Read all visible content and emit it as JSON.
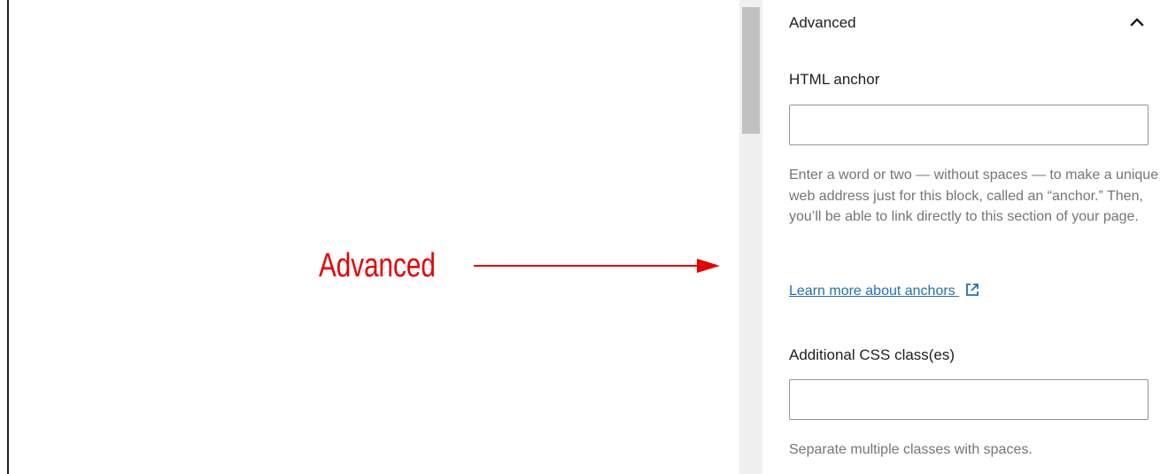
{
  "annotation": {
    "label": "Advanced",
    "color": "#e60000"
  },
  "panel": {
    "title": "Advanced",
    "toggle_icon": "chevron-up-icon",
    "html_anchor": {
      "label": "HTML anchor",
      "value": "",
      "placeholder": "",
      "help": "Enter a word or two — without spaces — to make a unique web address just for this block, called an “anchor.” Then, you’ll be able to link directly to this section of your page.",
      "link_label": "Learn more about anchors",
      "link_icon": "external-link-icon"
    },
    "css_classes": {
      "label": "Additional CSS class(es)",
      "value": "",
      "placeholder": "",
      "help": "Separate multiple classes with spaces."
    }
  },
  "colors": {
    "link": "#2271b1",
    "text": "#1e1e1e",
    "muted": "#757575",
    "border": "#949494"
  }
}
